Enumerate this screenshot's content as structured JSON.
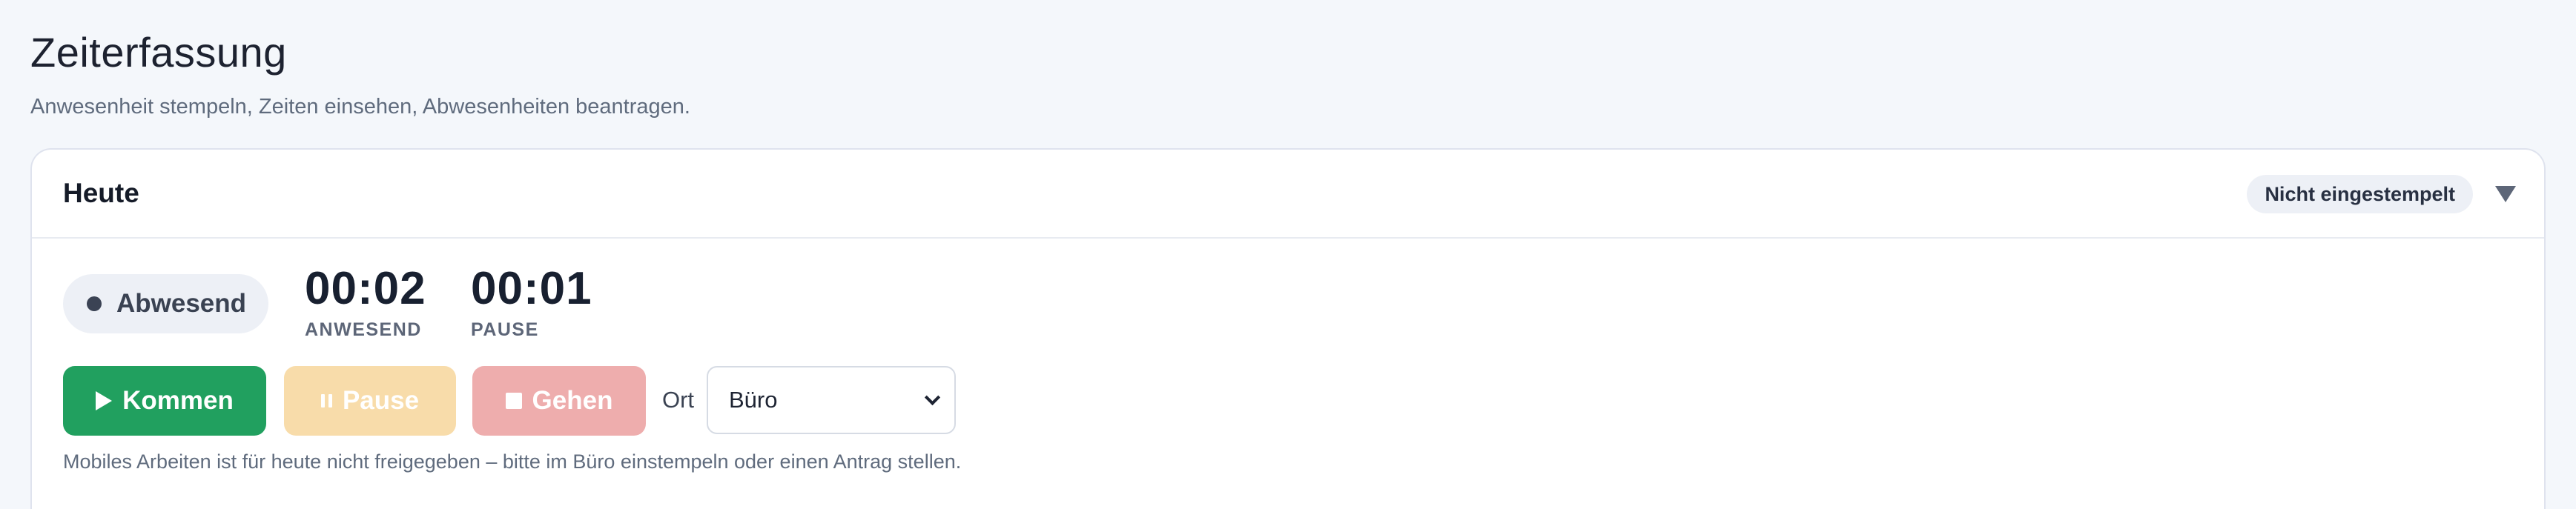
{
  "page": {
    "title": "Zeiterfassung",
    "subtitle": "Anwesenheit stempeln, Zeiten einsehen, Abwesenheiten beantragen."
  },
  "today_card": {
    "title": "Heute",
    "status_badge": "Nicht eingestempelt",
    "collapse_icon": "triangle-down-icon",
    "presence": {
      "label": "Abwesend",
      "dot_color": "#3b4354"
    },
    "timers": {
      "anwesend": {
        "value": "00:02",
        "caption": "ANWESEND"
      },
      "pause": {
        "value": "00:01",
        "caption": "PAUSE"
      }
    },
    "actions": {
      "kommen": {
        "label": "Kommen",
        "icon": "play-icon",
        "color": "#21a05f"
      },
      "pause": {
        "label": "Pause",
        "icon": "pause-icon",
        "color": "#f8dcaa"
      },
      "gehen": {
        "label": "Gehen",
        "icon": "stop-icon",
        "color": "#eeadad"
      }
    },
    "location": {
      "label": "Ort",
      "selected": "Büro"
    },
    "notice": "Mobiles Arbeiten ist für heute nicht freigegeben – bitte im Büro einstempeln oder einen Antrag stellen."
  }
}
